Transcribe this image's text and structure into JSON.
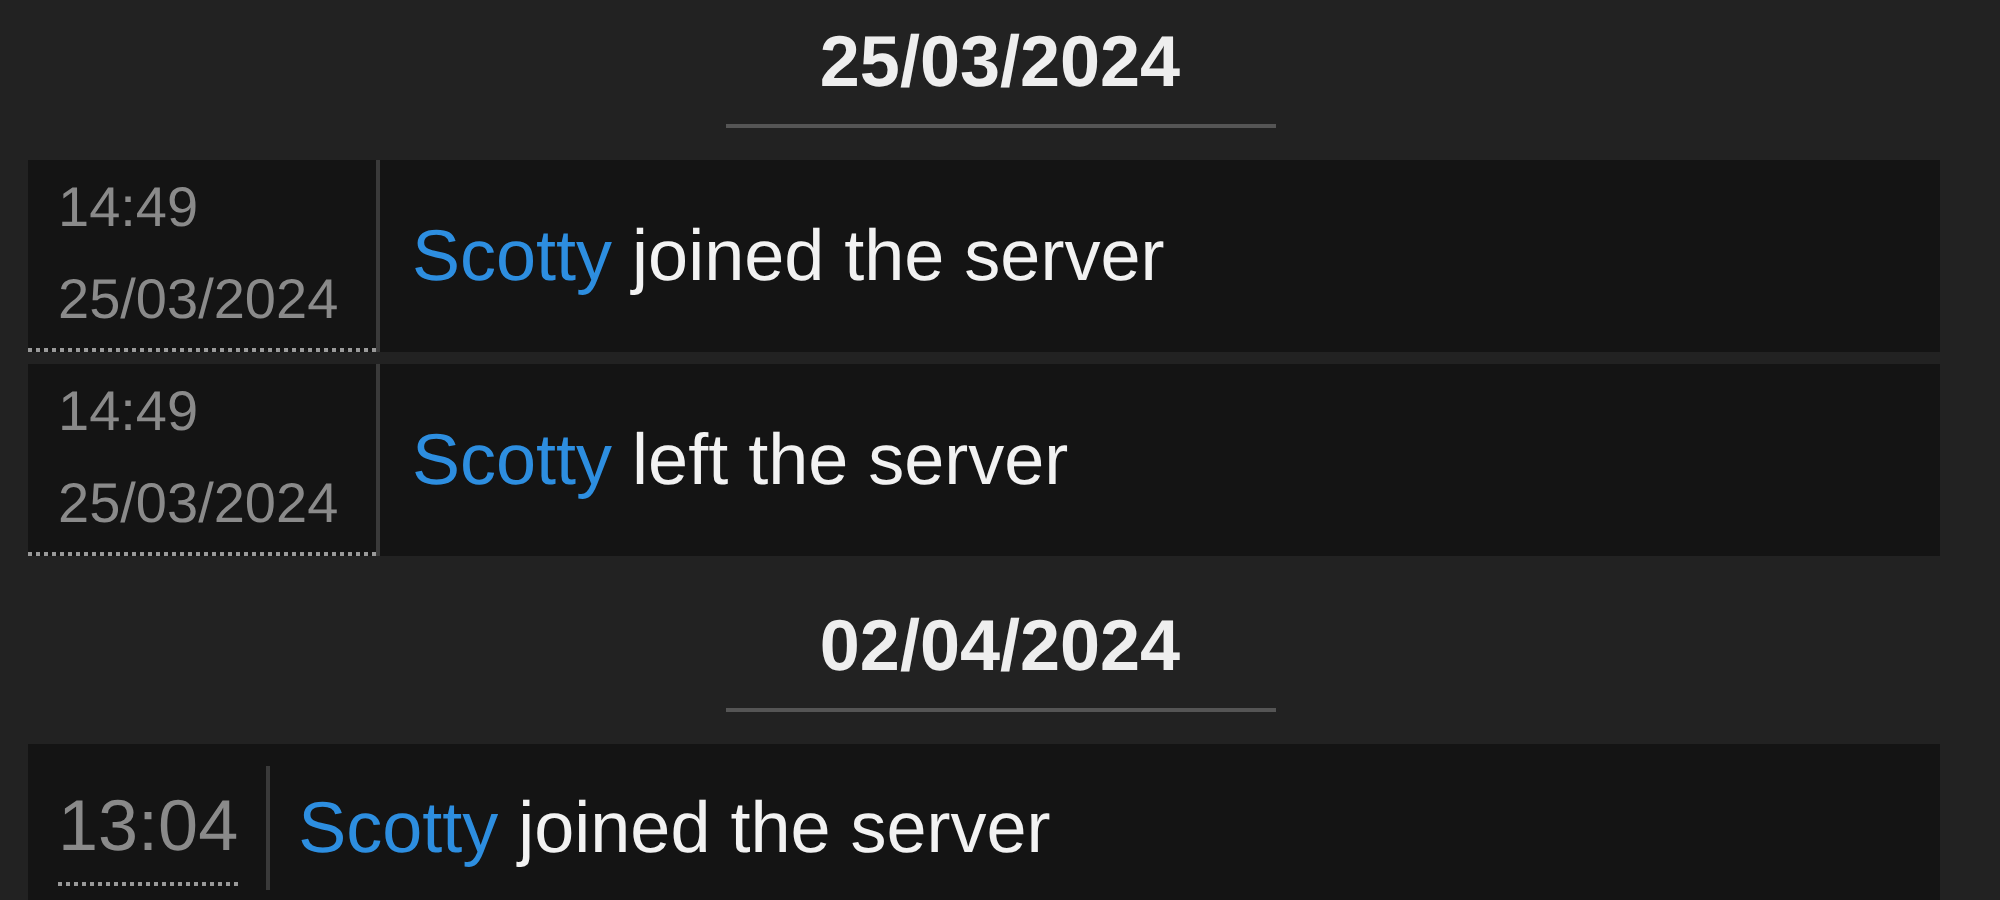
{
  "groups": [
    {
      "date": "25/03/2024",
      "messages": [
        {
          "kind": "full",
          "time": "14:49",
          "date": "25/03/2024",
          "user": "Scotty",
          "action": "joined the server"
        },
        {
          "kind": "full",
          "time": "14:49",
          "date": "25/03/2024",
          "user": "Scotty",
          "action": "left the server"
        }
      ]
    },
    {
      "date": "02/04/2024",
      "messages": [
        {
          "kind": "compact",
          "time": "13:04",
          "user": "Scotty",
          "action": "joined the server"
        }
      ]
    }
  ]
}
